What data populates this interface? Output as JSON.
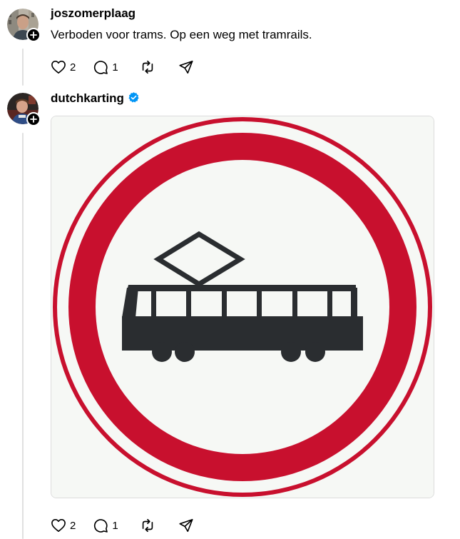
{
  "posts": [
    {
      "username": "joszomerplaag",
      "text": "Verboden voor trams. Op een weg met tramrails.",
      "verified": false,
      "likes": "2",
      "replies": "1"
    },
    {
      "username": "dutchkarting",
      "text": "",
      "verified": true,
      "likes": "2",
      "replies": "1"
    }
  ],
  "colors": {
    "sign_red": "#c8102e",
    "sign_white": "#f6f8f5",
    "tram": "#2a2d30",
    "verified_blue": "#0095f6"
  },
  "icons": [
    "plus-icon",
    "heart-icon",
    "comment-icon",
    "repost-icon",
    "share-icon",
    "verified-icon",
    "tram-icon"
  ]
}
